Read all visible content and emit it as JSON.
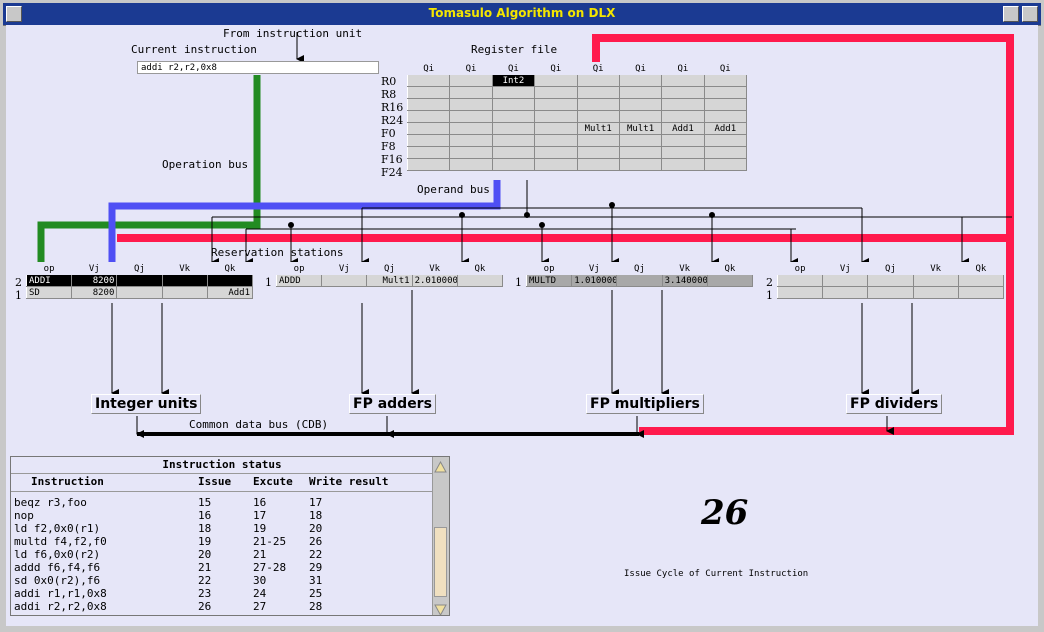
{
  "window": {
    "title": "Tomasulo Algorithm on DLX"
  },
  "labels": {
    "from_unit": "From instruction unit",
    "current_instruction": "Current instruction",
    "register_file": "Register file",
    "operation_bus": "Operation bus",
    "operand_bus": "Operand bus",
    "reservation_stations": "Reservation stations",
    "cdb": "Common data bus (CDB)"
  },
  "current_instruction": "addi r2,r2,0x8",
  "register_file": {
    "header": [
      "Qi",
      "Qi",
      "Qi",
      "Qi",
      "Qi",
      "Qi",
      "Qi",
      "Qi"
    ],
    "rows": [
      {
        "name": "R0",
        "cells": [
          "",
          "",
          "Int2",
          "",
          "",
          "",
          "",
          ""
        ]
      },
      {
        "name": "R8",
        "cells": [
          "",
          "",
          "",
          "",
          "",
          "",
          "",
          ""
        ]
      },
      {
        "name": "R16",
        "cells": [
          "",
          "",
          "",
          "",
          "",
          "",
          "",
          ""
        ]
      },
      {
        "name": "R24",
        "cells": [
          "",
          "",
          "",
          "",
          "",
          "",
          "",
          ""
        ]
      },
      {
        "name": "F0",
        "cells": [
          "",
          "",
          "",
          "",
          "Mult1",
          "Mult1",
          "Add1",
          "Add1"
        ]
      },
      {
        "name": "F8",
        "cells": [
          "",
          "",
          "",
          "",
          "",
          "",
          "",
          ""
        ]
      },
      {
        "name": "F16",
        "cells": [
          "",
          "",
          "",
          "",
          "",
          "",
          "",
          ""
        ]
      },
      {
        "name": "F24",
        "cells": [
          "",
          "",
          "",
          "",
          "",
          "",
          "",
          ""
        ]
      }
    ]
  },
  "rs_header": [
    "op",
    "Vj",
    "Qj",
    "Vk",
    "Qk"
  ],
  "reservation_stations": [
    {
      "unit": "Integer units",
      "rows": [
        {
          "idx": "2",
          "cells": [
            "ADDI",
            "8200",
            "",
            "",
            ""
          ],
          "style": "dark"
        },
        {
          "idx": "1",
          "cells": [
            "SD",
            "8200",
            "",
            "",
            "Add1"
          ],
          "style": ""
        }
      ]
    },
    {
      "unit": "FP adders",
      "rows": [
        {
          "idx": "1",
          "cells": [
            "ADDD",
            "",
            "Mult1",
            "2.010000",
            ""
          ],
          "style": ""
        }
      ]
    },
    {
      "unit": "FP multipliers",
      "rows": [
        {
          "idx": "1",
          "cells": [
            "MULTD",
            "1.010000",
            "",
            "3.140000",
            ""
          ],
          "style": "grey"
        }
      ]
    },
    {
      "unit": "FP dividers",
      "rows": [
        {
          "idx": "2",
          "cells": [
            "",
            "",
            "",
            "",
            ""
          ],
          "style": ""
        },
        {
          "idx": "1",
          "cells": [
            "",
            "",
            "",
            "",
            ""
          ],
          "style": ""
        }
      ]
    }
  ],
  "instruction_status": {
    "title": "Instruction status",
    "headers": [
      "Instruction",
      "Issue",
      "Excute",
      "Write result"
    ],
    "rows": [
      [
        "beqz r3,foo",
        "15",
        "16",
        "17"
      ],
      [
        "nop",
        "16",
        "17",
        "18"
      ],
      [
        "ld f2,0x0(r1)",
        "18",
        "19",
        "20"
      ],
      [
        "multd f4,f2,f0",
        "19",
        "21-25",
        "26"
      ],
      [
        "ld f6,0x0(r2)",
        "20",
        "21",
        "22"
      ],
      [
        "addd f6,f4,f6",
        "21",
        "27-28",
        "29"
      ],
      [
        "sd 0x0(r2),f6",
        "22",
        "30",
        "31"
      ],
      [
        "addi r1,r1,0x8",
        "23",
        "24",
        "25"
      ],
      [
        "addi r2,r2,0x8",
        "26",
        "27",
        "28"
      ]
    ]
  },
  "issue_cycle": {
    "value": "26",
    "label": "Issue Cycle of Current Instruction"
  },
  "colors": {
    "red": "#ff1a4d",
    "green": "#228b22",
    "blue": "#4f4ff4",
    "title_text": "#f4e600",
    "titlebar": "#1b3a92",
    "background": "#e6e6f8"
  }
}
